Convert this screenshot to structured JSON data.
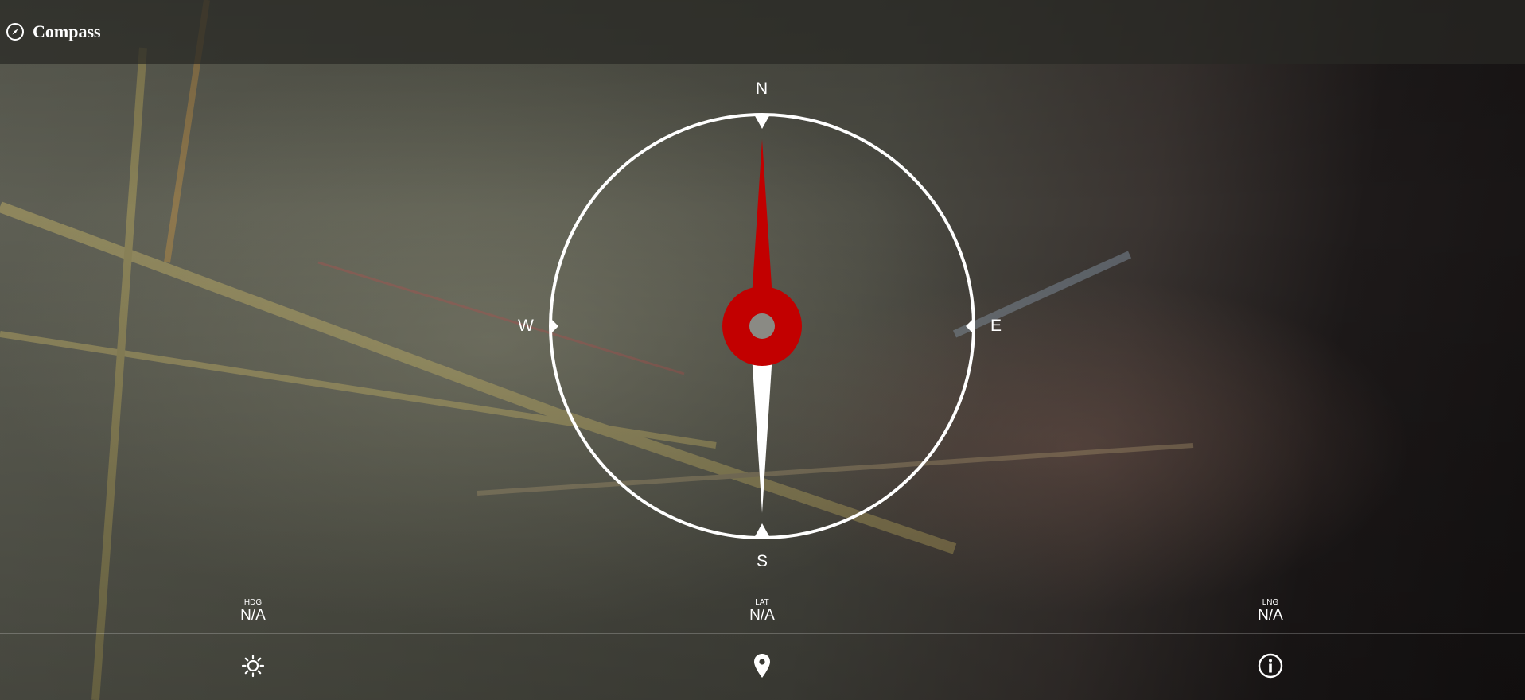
{
  "header": {
    "title": "Compass",
    "icon": "compass-icon"
  },
  "compass": {
    "north": "N",
    "south": "S",
    "east": "E",
    "west": "W",
    "needle_north_color": "#c20000",
    "needle_south_color": "#ffffff",
    "ring_color": "#ffffff"
  },
  "readouts": {
    "hdg": {
      "label": "HDG",
      "value": "N/A"
    },
    "lat": {
      "label": "LAT",
      "value": "N/A"
    },
    "lng": {
      "label": "LNG",
      "value": "N/A"
    }
  },
  "toolbar": {
    "left_icon": "sun-icon",
    "center_icon": "location-pin-icon",
    "right_icon": "info-icon"
  }
}
